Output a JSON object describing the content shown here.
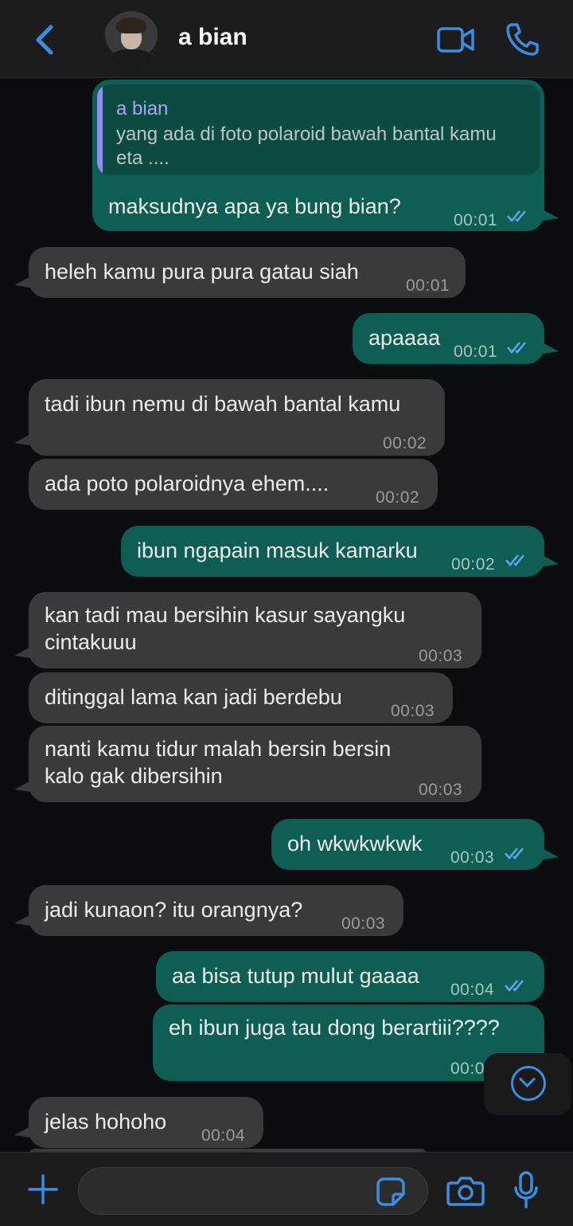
{
  "header": {
    "contact_name": "a bian",
    "icons": [
      "back-chevron-icon",
      "avatar",
      "video-call-icon",
      "phone-call-icon"
    ]
  },
  "messages": [
    {
      "dir": "out",
      "quote": {
        "name": "a bian",
        "text": "yang ada di foto polaroid bawah bantal kamu eta ...."
      },
      "text": "maksudnya apa ya bung bian?",
      "time": "00:01",
      "read": true
    },
    {
      "dir": "in",
      "text": "heleh kamu pura pura gatau siah",
      "time": "00:01"
    },
    {
      "dir": "out",
      "text": "apaaaa",
      "time": "00:01",
      "read": true
    },
    {
      "dir": "in",
      "text": "tadi ibun nemu di bawah bantal kamu",
      "time": "00:02"
    },
    {
      "dir": "in",
      "text": "ada poto polaroidnya ehem....",
      "time": "00:02"
    },
    {
      "dir": "out",
      "text": "ibun ngapain masuk kamarku",
      "time": "00:02",
      "read": true
    },
    {
      "dir": "in",
      "lines": [
        "kan tadi mau bersihin kasur sayangku",
        "cintakuuu"
      ],
      "time": "00:03"
    },
    {
      "dir": "in",
      "text": "ditinggal lama kan jadi berdebu",
      "time": "00:03"
    },
    {
      "dir": "in",
      "lines": [
        "nanti kamu tidur malah bersin bersin",
        "kalo gak dibersihin"
      ],
      "time": "00:03"
    },
    {
      "dir": "out",
      "text": "oh wkwkwkwk",
      "time": "00:03",
      "read": true
    },
    {
      "dir": "in",
      "text": "jadi kunaon? itu orangnya?",
      "time": "00:03"
    },
    {
      "dir": "out",
      "text": "aa bisa tutup mulut gaaaa",
      "time": "00:04",
      "read": true
    },
    {
      "dir": "out",
      "text": "eh ibun juga tau dong berartiii????",
      "time": "00:04",
      "read": true
    },
    {
      "dir": "in",
      "text": "jelas hohoho",
      "time": "00:04"
    }
  ],
  "composer": {
    "placeholder": "",
    "icons": [
      "plus-icon",
      "sticker-icon",
      "camera-icon",
      "microphone-icon"
    ]
  },
  "colors": {
    "accent": "#3b8de0",
    "incoming_bubble": "#3a3a3c",
    "outgoing_bubble": "#0f5e54",
    "background": "#0b0d10",
    "read_ticks": "#5aa9f0"
  }
}
